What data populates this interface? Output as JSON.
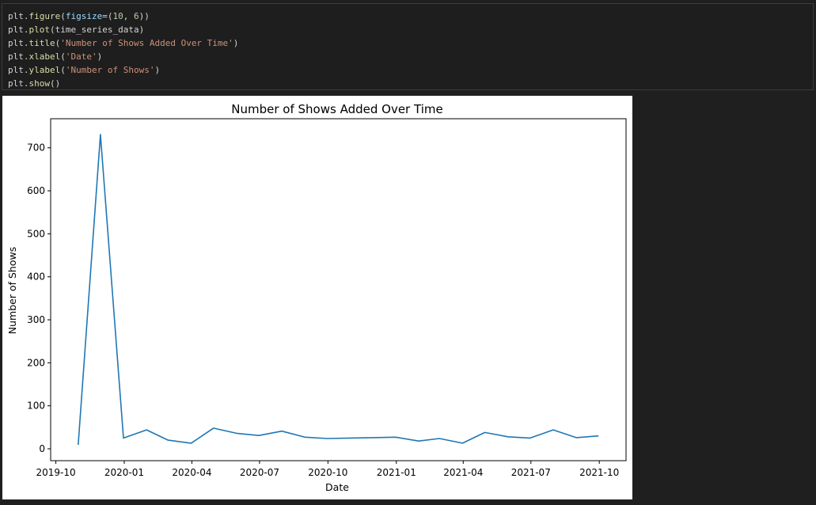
{
  "code": {
    "lines": [
      [
        {
          "t": "plt",
          "c": "var"
        },
        {
          "t": ".",
          "c": "plain"
        },
        {
          "t": "figure",
          "c": "fn"
        },
        {
          "t": "(",
          "c": "plain"
        },
        {
          "t": "figsize",
          "c": "kw"
        },
        {
          "t": "=",
          "c": "op"
        },
        {
          "t": "(",
          "c": "plain"
        },
        {
          "t": "10",
          "c": "num"
        },
        {
          "t": ", ",
          "c": "plain"
        },
        {
          "t": "6",
          "c": "num"
        },
        {
          "t": "))",
          "c": "plain"
        }
      ],
      [
        {
          "t": "plt",
          "c": "var"
        },
        {
          "t": ".",
          "c": "plain"
        },
        {
          "t": "plot",
          "c": "fn"
        },
        {
          "t": "(time_series_data)",
          "c": "plain"
        }
      ],
      [
        {
          "t": "plt",
          "c": "var"
        },
        {
          "t": ".",
          "c": "plain"
        },
        {
          "t": "title",
          "c": "fn"
        },
        {
          "t": "(",
          "c": "plain"
        },
        {
          "t": "'Number of Shows Added Over Time'",
          "c": "str"
        },
        {
          "t": ")",
          "c": "plain"
        }
      ],
      [
        {
          "t": "plt",
          "c": "var"
        },
        {
          "t": ".",
          "c": "plain"
        },
        {
          "t": "xlabel",
          "c": "fn"
        },
        {
          "t": "(",
          "c": "plain"
        },
        {
          "t": "'Date'",
          "c": "str"
        },
        {
          "t": ")",
          "c": "plain"
        }
      ],
      [
        {
          "t": "plt",
          "c": "var"
        },
        {
          "t": ".",
          "c": "plain"
        },
        {
          "t": "ylabel",
          "c": "fn"
        },
        {
          "t": "(",
          "c": "plain"
        },
        {
          "t": "'Number of Shows'",
          "c": "str"
        },
        {
          "t": ")",
          "c": "plain"
        }
      ],
      [
        {
          "t": "plt",
          "c": "var"
        },
        {
          "t": ".",
          "c": "plain"
        },
        {
          "t": "show",
          "c": "fn"
        },
        {
          "t": "()",
          "c": "plain"
        }
      ]
    ]
  },
  "colors": {
    "line": "#1f77b4",
    "axes": "#000000",
    "background": "#1f1f1f"
  },
  "chart_data": {
    "type": "line",
    "title": "Number of Shows Added Over Time",
    "xlabel": "Date",
    "ylabel": "Number of Shows",
    "x": [
      "2019-10-31",
      "2019-11-30",
      "2019-12-31",
      "2020-01-31",
      "2020-02-29",
      "2020-03-31",
      "2020-04-30",
      "2020-05-31",
      "2020-06-30",
      "2020-07-31",
      "2020-08-31",
      "2020-09-30",
      "2020-10-31",
      "2020-11-30",
      "2020-12-31",
      "2021-01-31",
      "2021-02-28",
      "2021-03-31",
      "2021-04-30",
      "2021-05-31",
      "2021-06-30",
      "2021-07-31",
      "2021-08-31",
      "2021-09-30"
    ],
    "series": [
      {
        "values": [
          9,
          731,
          25,
          44,
          20,
          13,
          48,
          36,
          31,
          41,
          27,
          24,
          25,
          26,
          27,
          18,
          24,
          13,
          38,
          28,
          25,
          44,
          26,
          30
        ]
      }
    ],
    "xticks": [
      "2019-10",
      "2020-01",
      "2020-04",
      "2020-07",
      "2020-10",
      "2021-01",
      "2021-04",
      "2021-07",
      "2021-10"
    ],
    "yticks": [
      0,
      100,
      200,
      300,
      400,
      500,
      600,
      700
    ],
    "xlim": [
      "2019-09-24",
      "2021-11-06"
    ],
    "ylim": [
      -27.6,
      767.6
    ],
    "grid": false,
    "legend": "none"
  }
}
